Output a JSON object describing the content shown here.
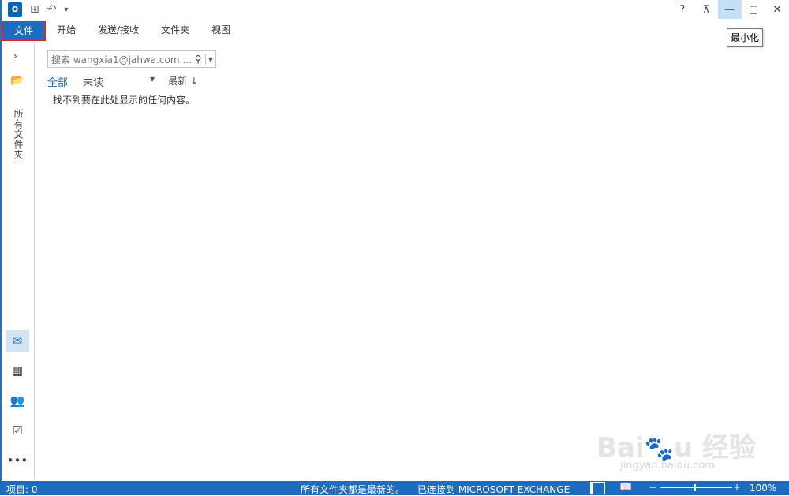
{
  "app": {
    "icon_label": "O",
    "undo_icon": "↶",
    "qat_more_icon": "▾"
  },
  "window": {
    "help": "?",
    "restore_ribbon": "⊼",
    "minimize": "—",
    "maximize": "□",
    "close": "✕",
    "tooltip": "最小化"
  },
  "ribbon": {
    "tabs": [
      "文件",
      "开始",
      "发送/接收",
      "文件夹",
      "视图"
    ]
  },
  "nav": {
    "expand_icon": "›",
    "folder_icon": "📂",
    "all_folders_label": "所有文件夹",
    "items": [
      {
        "name": "mail",
        "icon": "✉"
      },
      {
        "name": "calendar",
        "icon": "▦"
      },
      {
        "name": "people",
        "icon": "👥"
      },
      {
        "name": "tasks",
        "icon": "☑"
      },
      {
        "name": "more",
        "icon": "•••"
      }
    ]
  },
  "message_list": {
    "search_placeholder": "搜索 wangxia1@jahwa.com....",
    "search_icon": "⚲",
    "filter_all": "全部",
    "filter_unread": "未读",
    "sort_label": "最新 ↓",
    "empty_text": "找不到要在此处显示的任何内容。"
  },
  "status": {
    "items_count": "项目: 0",
    "folders_status": "所有文件夹都是最新的。",
    "connection": "已连接到 MICROSOFT EXCHANGE",
    "zoom_minus": "−",
    "zoom_plus": "+",
    "zoom_level": "100%"
  },
  "watermark": {
    "text": "Bai 经验",
    "url": "jingyan.baidu.com"
  }
}
